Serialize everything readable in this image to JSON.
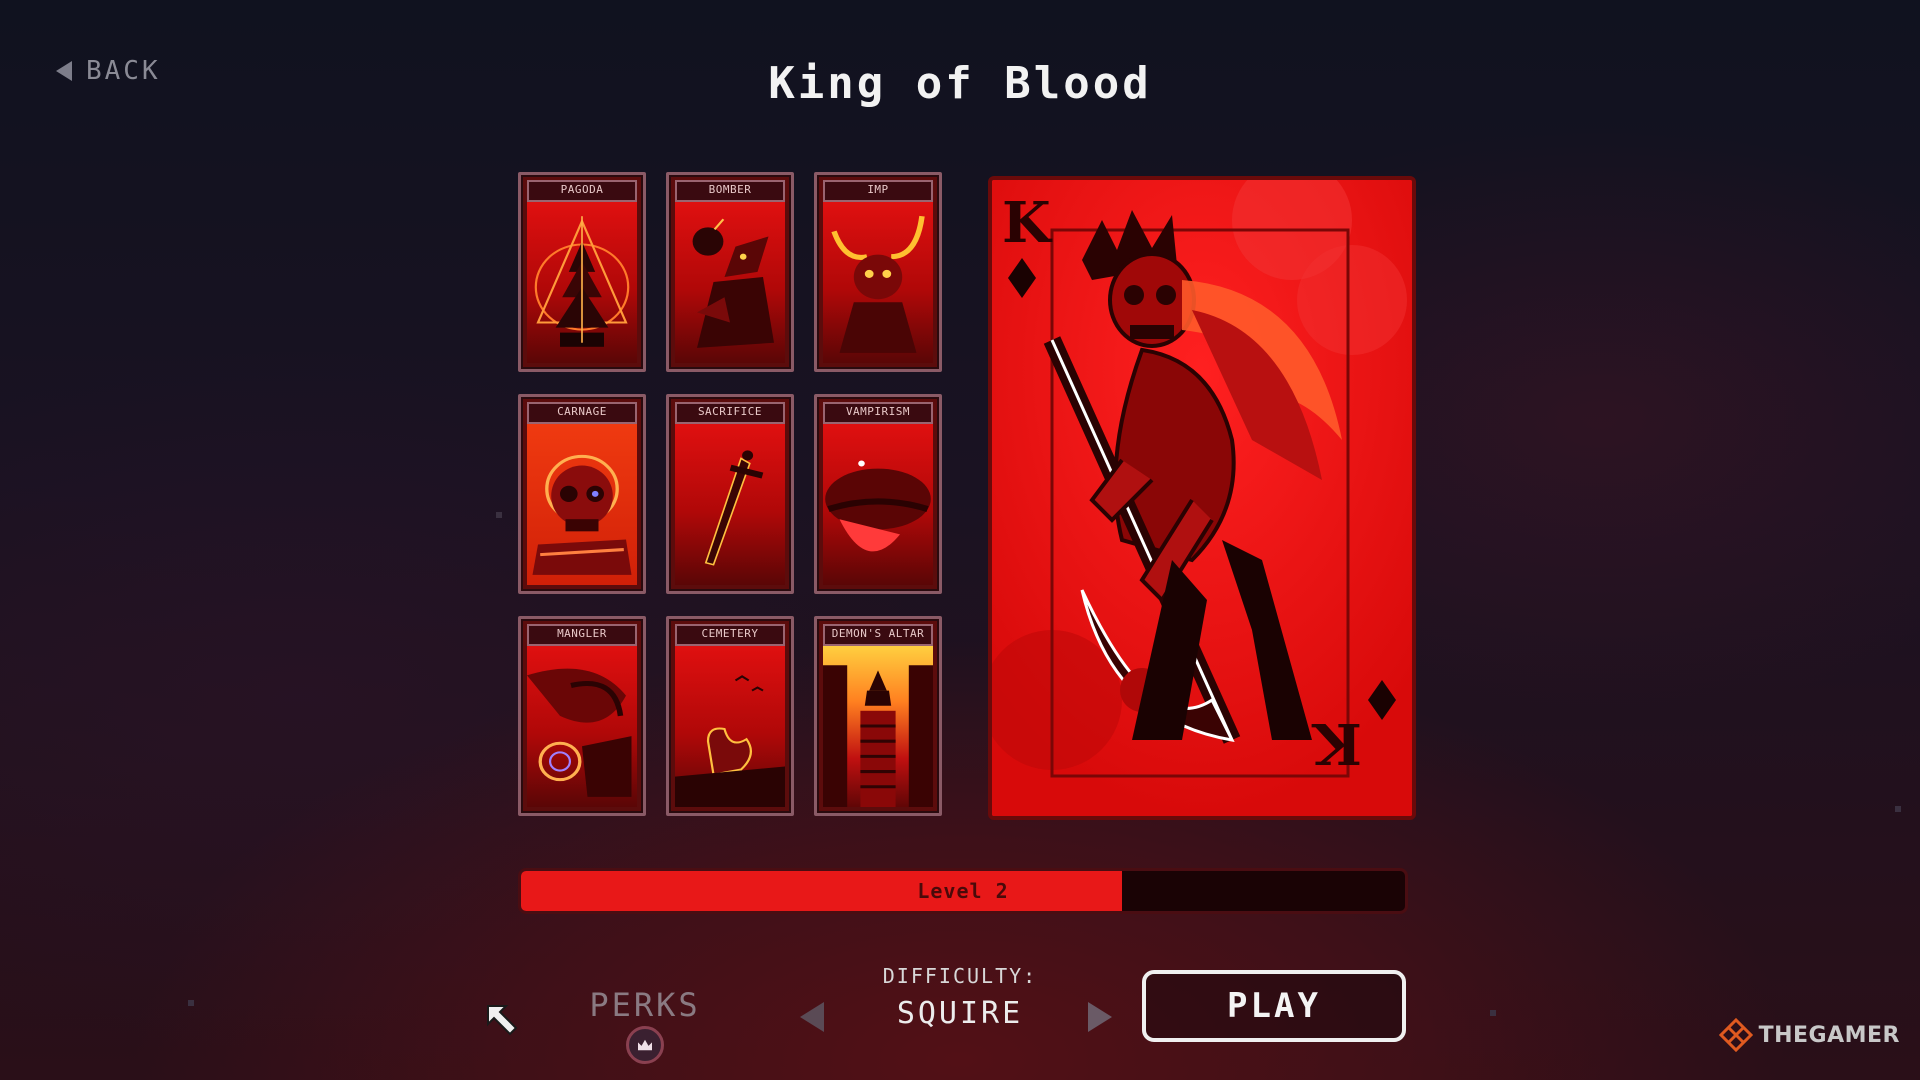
{
  "header": {
    "back_label": "BACK",
    "title": "King of Blood"
  },
  "cards": [
    {
      "label": "PAGODA",
      "icon": "pagoda-icon"
    },
    {
      "label": "BOMBER",
      "icon": "bomber-icon"
    },
    {
      "label": "IMP",
      "icon": "imp-icon"
    },
    {
      "label": "CARNAGE",
      "icon": "skull-icon"
    },
    {
      "label": "SACRIFICE",
      "icon": "dagger-icon"
    },
    {
      "label": "VAMPIRISM",
      "icon": "fang-icon"
    },
    {
      "label": "MANGLER",
      "icon": "mangler-icon"
    },
    {
      "label": "CEMETERY",
      "icon": "cemetery-icon"
    },
    {
      "label": "DEMON'S ALTAR",
      "icon": "altar-icon"
    }
  ],
  "featured_card": {
    "rank": "K",
    "suit": "diamond",
    "icon": "skeleton-king-icon"
  },
  "level": {
    "label": "Level 2",
    "progress": 0.68
  },
  "controls": {
    "perks_label": "PERKS",
    "difficulty_label": "DIFFICULTY:",
    "difficulty_value": "SQUIRE",
    "play_label": "PLAY"
  },
  "watermark": "THEGAMER",
  "colors": {
    "accent_red": "#e81818",
    "card_red": "#e80f0f",
    "dark_bg": "#140d16",
    "text": "#f2f2f2"
  }
}
